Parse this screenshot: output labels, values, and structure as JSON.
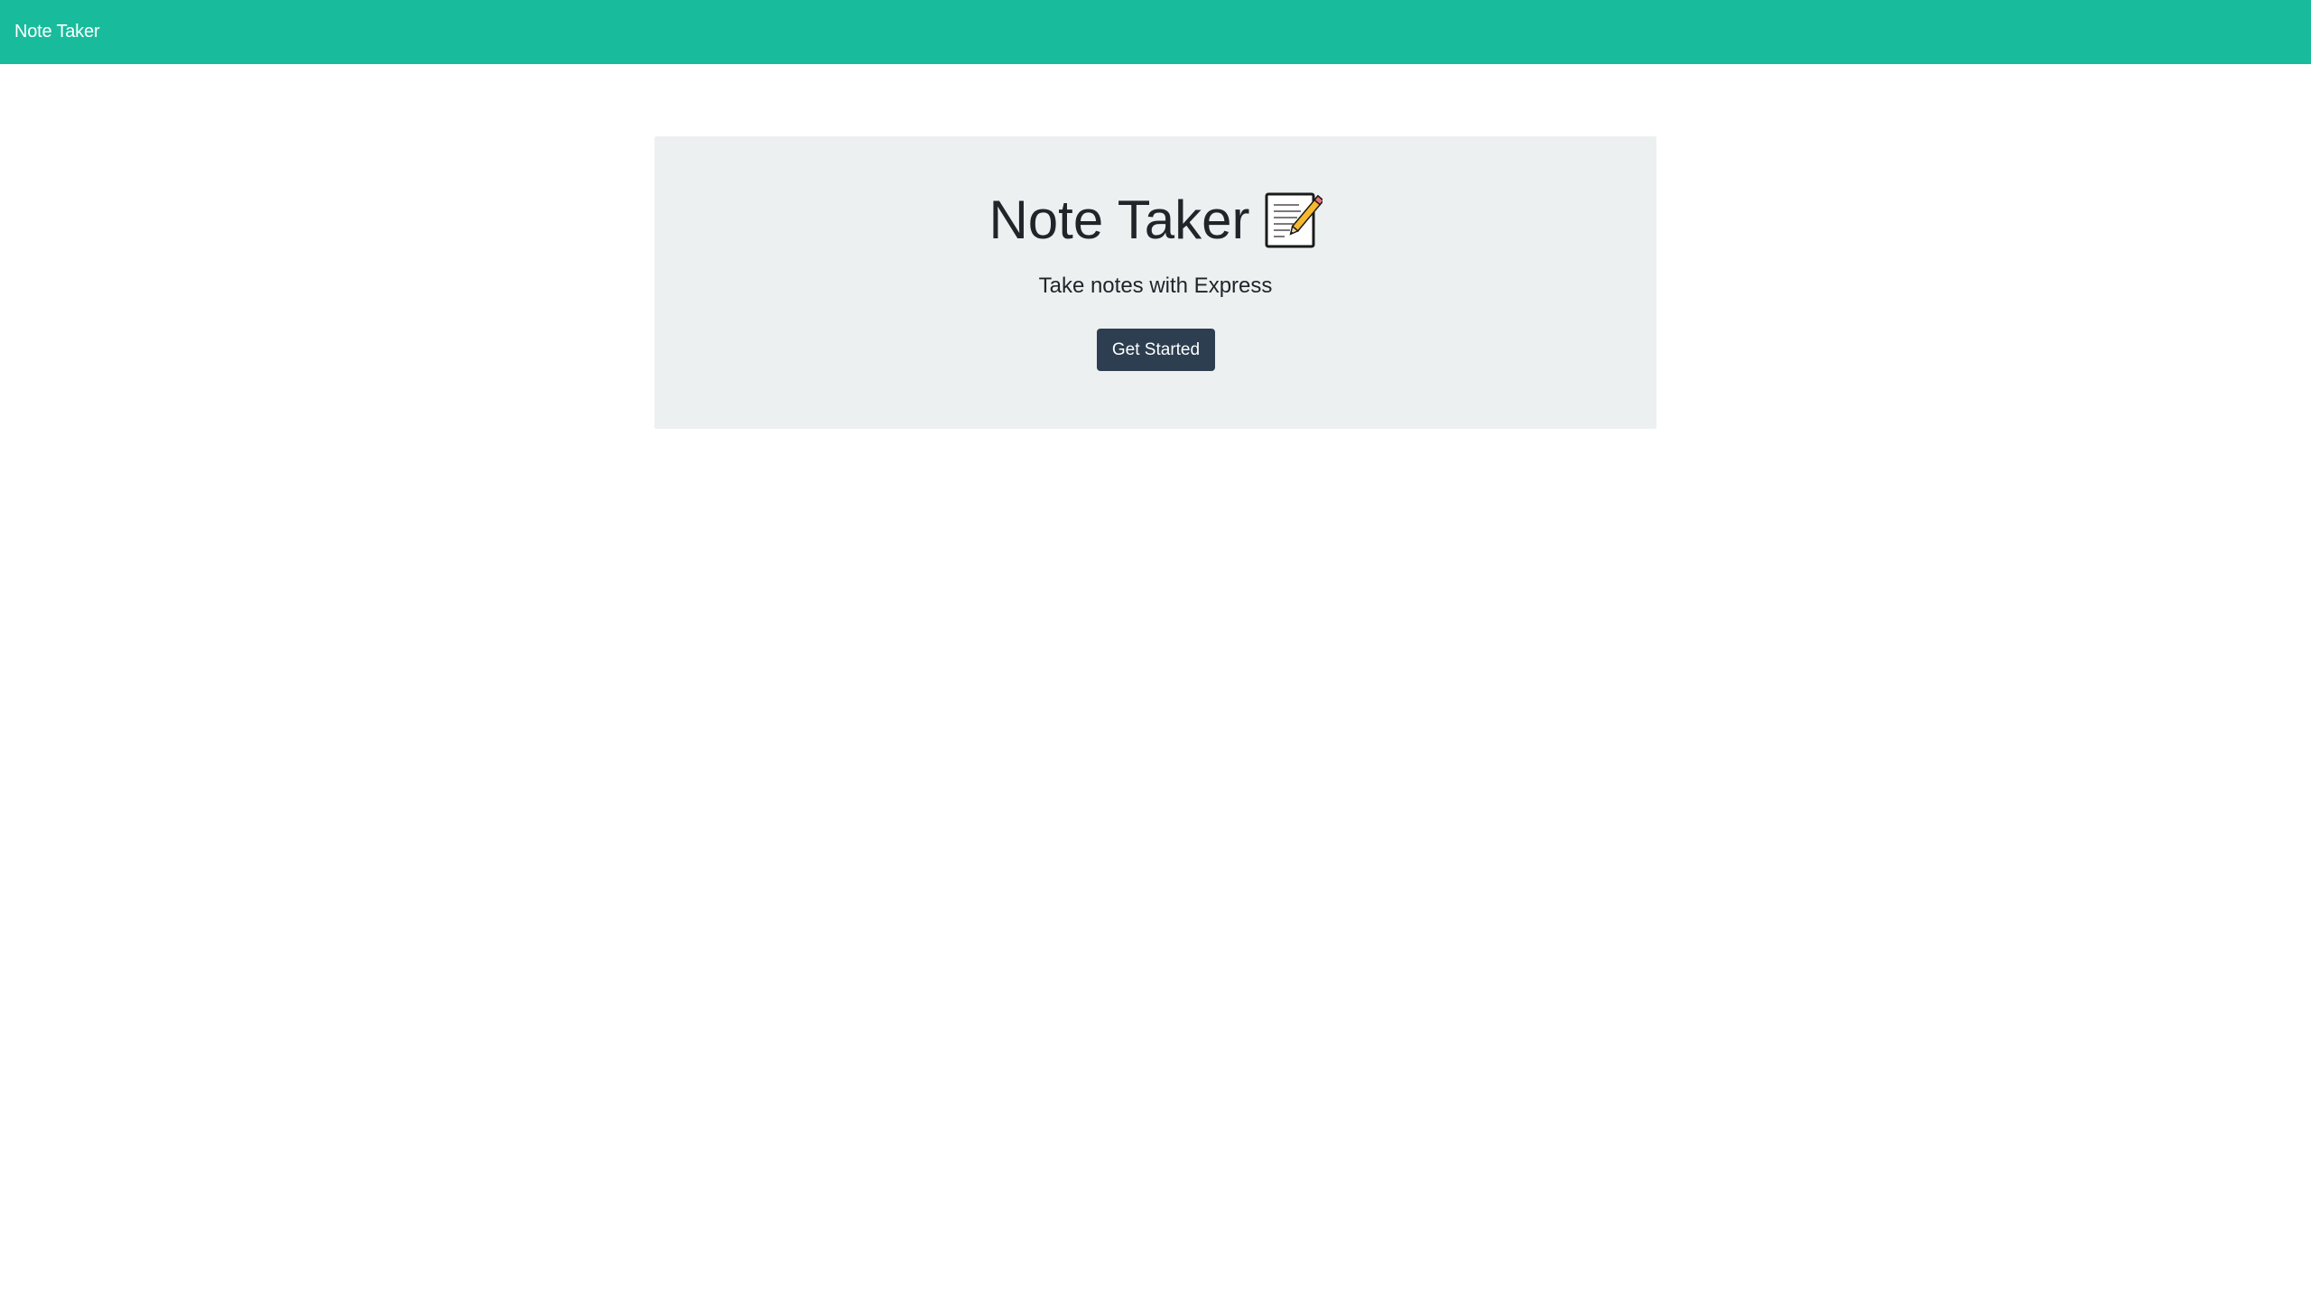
{
  "navbar": {
    "brand": "Note Taker",
    "background": "#18bc9c"
  },
  "hero": {
    "title": "Note Taker",
    "title_icon": "memo-icon",
    "subtitle": "Take notes with Express",
    "button_label": "Get Started",
    "button_color": "#2c3e50",
    "background": "#ecf0f1"
  }
}
